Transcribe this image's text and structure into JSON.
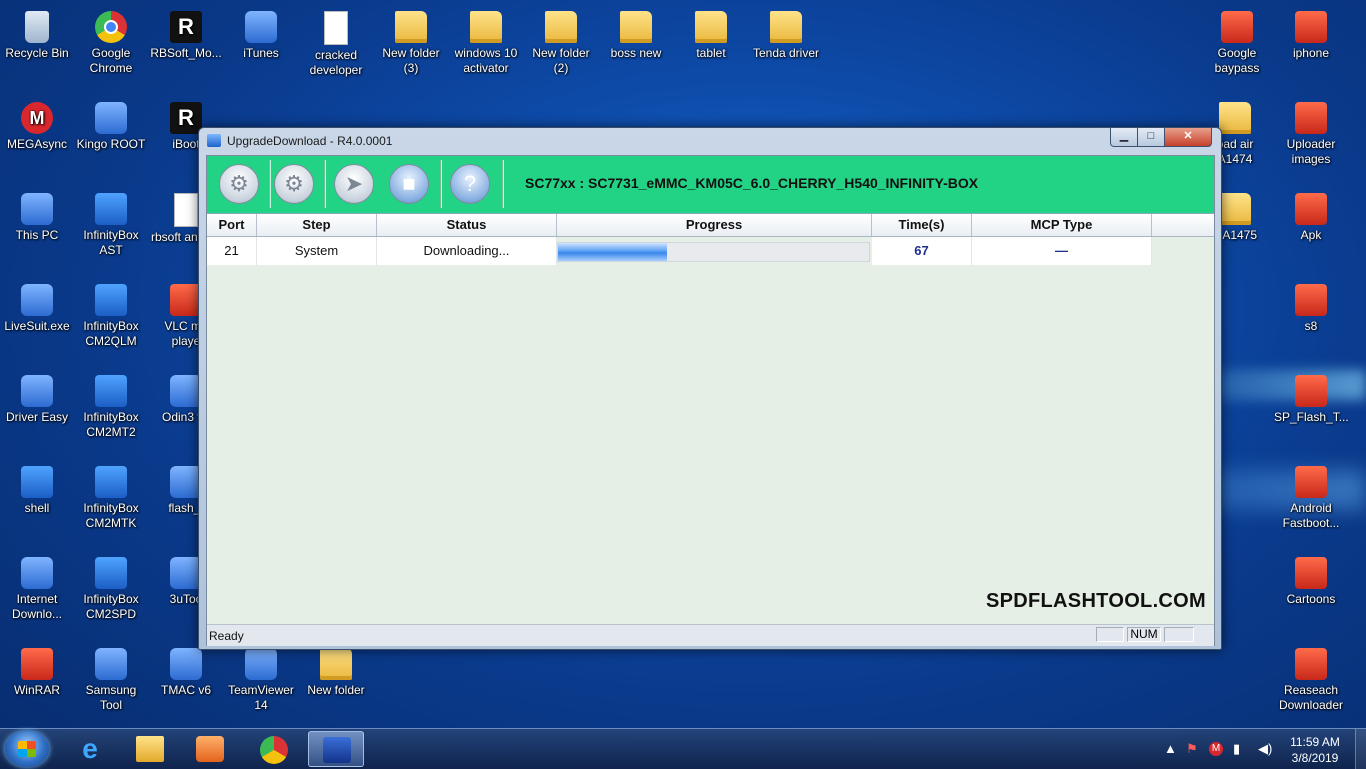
{
  "desktop": {
    "icons_left": [
      {
        "label": "Recycle Bin",
        "type": "bin"
      },
      {
        "label": "Google Chrome",
        "type": "chrome"
      },
      {
        "label": "RBSoft_Mo...",
        "type": "dark"
      },
      {
        "label": "iTunes",
        "type": "app"
      },
      {
        "label": "cracked developer",
        "type": "doc"
      },
      {
        "label": "New folder (3)",
        "type": "folder"
      },
      {
        "label": "windows 10 activator",
        "type": "folder"
      },
      {
        "label": "New folder (2)",
        "type": "folder"
      },
      {
        "label": "boss new",
        "type": "folder"
      },
      {
        "label": "tablet",
        "type": "folder"
      },
      {
        "label": "Tenda driver",
        "type": "folder"
      },
      {
        "label": "MEGAsync",
        "type": "mega"
      },
      {
        "label": "Kingo ROOT",
        "type": "app"
      },
      {
        "label": "iBoot",
        "type": "dark"
      },
      {
        "label": "This PC",
        "type": "app"
      },
      {
        "label": "InfinityBox AST",
        "type": "shield"
      },
      {
        "label": "rbsoft and pa",
        "type": "doc"
      },
      {
        "label": "LiveSuit.exe",
        "type": "app"
      },
      {
        "label": "InfinityBox CM2QLM",
        "type": "shield"
      },
      {
        "label": "VLC me playe",
        "type": "red"
      },
      {
        "label": "Driver Easy",
        "type": "app"
      },
      {
        "label": "InfinityBox CM2MT2",
        "type": "shield"
      },
      {
        "label": "Odin3 v3",
        "type": "app"
      },
      {
        "label": "shell",
        "type": "shield"
      },
      {
        "label": "InfinityBox CM2MTK",
        "type": "shield"
      },
      {
        "label": "flash_t",
        "type": "app"
      },
      {
        "label": "Internet Downlo...",
        "type": "app"
      },
      {
        "label": "InfinityBox CM2SPD",
        "type": "shield"
      },
      {
        "label": "3uToo",
        "type": "app"
      },
      {
        "label": "WinRAR",
        "type": "red"
      },
      {
        "label": "Samsung Tool",
        "type": "app"
      },
      {
        "label": "TMAC v6",
        "type": "app"
      },
      {
        "label": "TeamViewer 14",
        "type": "app"
      },
      {
        "label": "New folder",
        "type": "folder"
      }
    ],
    "icons_right": [
      {
        "label": "Google baypass",
        "type": "red"
      },
      {
        "label": "iphone",
        "type": "red"
      },
      {
        "label": "oad air A1474",
        "type": "folder"
      },
      {
        "label": "Uploader images",
        "type": "red"
      },
      {
        "label": "d A1475",
        "type": "folder"
      },
      {
        "label": "Apk",
        "type": "red"
      },
      {
        "label": "s8",
        "type": "red"
      },
      {
        "label": "SP_Flash_T...",
        "type": "red"
      },
      {
        "label": "Android Fastboot...",
        "type": "red"
      },
      {
        "label": "Cartoons",
        "type": "red"
      },
      {
        "label": "Reaseach Downloader",
        "type": "red"
      }
    ]
  },
  "window": {
    "title": "UpgradeDownload - R4.0.0001",
    "controls": {
      "minimize": "▁",
      "maximize": "□",
      "close": "✕"
    },
    "toolbar": {
      "device_title": "SC77xx : SC7731_eMMC_KM05C_6.0_CHERRY_H540_INFINITY-BOX",
      "buttons": [
        {
          "name": "load-packet",
          "icon": "gear-icon"
        },
        {
          "name": "settings",
          "icon": "gears-icon"
        },
        {
          "name": "start",
          "icon": "play-icon"
        },
        {
          "name": "stop",
          "icon": "stop-icon"
        },
        {
          "name": "help",
          "icon": "help-icon"
        }
      ]
    },
    "grid": {
      "headers": [
        "Port",
        "Step",
        "Status",
        "Progress",
        "Time(s)",
        "MCP Type"
      ],
      "rows": [
        {
          "port": "21",
          "step": "System",
          "status": "Downloading...",
          "progress": 0.35,
          "time": "67",
          "mcp": "—"
        }
      ]
    },
    "watermark": "SPDFLASHTOOL.COM",
    "statusbar": {
      "status": "Ready",
      "num": "NUM"
    }
  },
  "taskbar": {
    "apps": [
      {
        "name": "internet-explorer",
        "icon": "ie-icon"
      },
      {
        "name": "file-explorer",
        "icon": "folder-icon"
      },
      {
        "name": "media-player",
        "icon": "media-icon"
      },
      {
        "name": "chrome",
        "icon": "chrome-icon"
      },
      {
        "name": "upgrade-download",
        "icon": "flash-tool-icon",
        "active": true
      }
    ],
    "clock": {
      "time": "11:59 AM",
      "date": "3/8/2019"
    }
  }
}
